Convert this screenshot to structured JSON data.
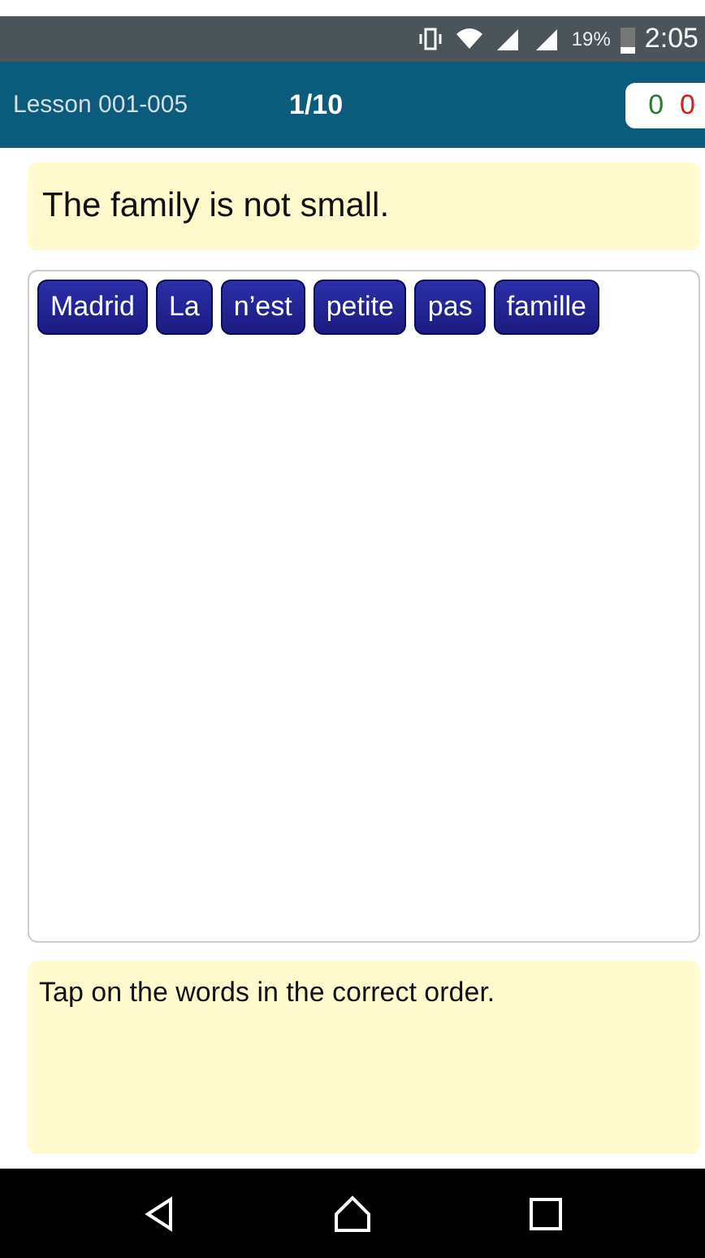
{
  "status_bar": {
    "battery": "19%",
    "time": "2:05"
  },
  "header": {
    "lesson": "Lesson 001-005",
    "progress": "1/10",
    "score": {
      "correct": "0",
      "wrong": "0"
    }
  },
  "prompt": "The family is not small.",
  "word_tiles": [
    "Madrid",
    "La",
    "n’est",
    "petite",
    "pas",
    "famille"
  ],
  "instruction": "Tap on the words in the correct order."
}
